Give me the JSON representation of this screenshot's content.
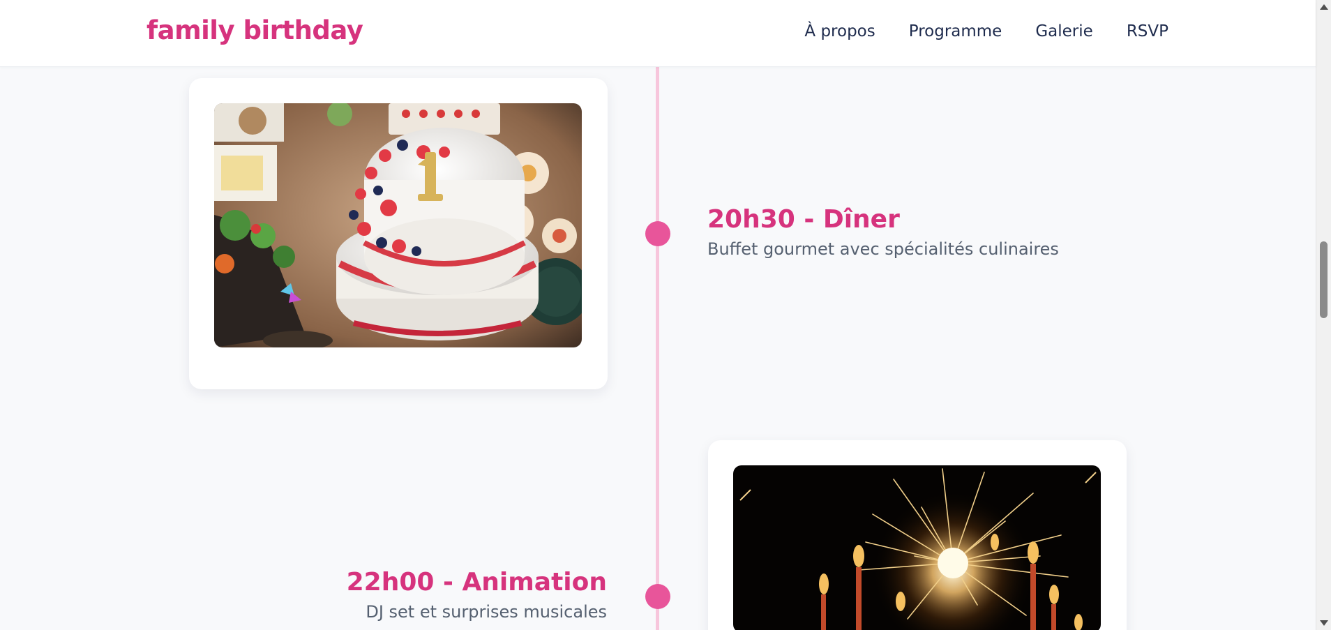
{
  "header": {
    "brand": "family birthday",
    "nav": [
      "À propos",
      "Programme",
      "Galerie",
      "RSVP"
    ]
  },
  "timeline": {
    "events": [
      {
        "title": "20h30 - Dîner",
        "description": "Buffet gourmet avec spécialités culinaires",
        "image": "birthday-cake-photo"
      },
      {
        "title": "22h00 - Animation",
        "description": "DJ set et surprises musicales",
        "image": "sparkler-candles-photo"
      }
    ]
  },
  "colors": {
    "accent": "#d6337d",
    "dot": "#e8559a",
    "line": "#f7c6dc",
    "nav_text": "#1e2b4d",
    "body_text": "#556070"
  }
}
